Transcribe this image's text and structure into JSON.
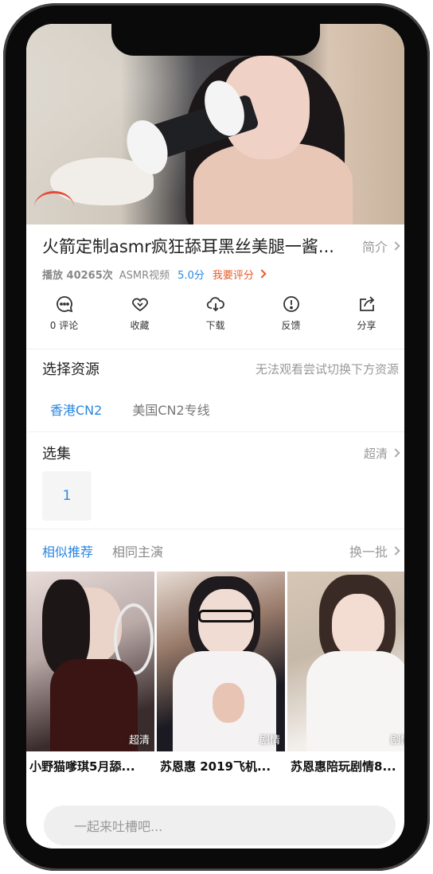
{
  "video": {
    "title": "火箭定制asmr疯狂舔耳黑丝美腿一酱...",
    "intro_label": "简介"
  },
  "meta": {
    "plays": "播放 40265次",
    "category": "ASMR视频",
    "score": "5.0分",
    "rate_label": "我要评分"
  },
  "actions": [
    {
      "label": "0 评论",
      "icon": "comment-icon"
    },
    {
      "label": "收藏",
      "icon": "favorite-icon"
    },
    {
      "label": "下载",
      "icon": "download-icon"
    },
    {
      "label": "反馈",
      "icon": "feedback-icon"
    },
    {
      "label": "分享",
      "icon": "share-icon"
    }
  ],
  "source_section": {
    "title": "选择资源",
    "hint": "无法观看尝试切换下方资源",
    "sources": [
      "香港CN2",
      "美国CN2专线"
    ],
    "active": 0
  },
  "episode_section": {
    "title": "选集",
    "quality": "超清",
    "episodes": [
      "1"
    ]
  },
  "recommend": {
    "tabs": [
      "相似推荐",
      "相同主演"
    ],
    "refresh_label": "换一批",
    "items": [
      {
        "caption": "小野猫嗲琪5月舔...",
        "badge": "超清"
      },
      {
        "caption": "苏恩惠 2019飞机...",
        "badge": "剧情"
      },
      {
        "caption": "苏恩惠陪玩剧情8...",
        "badge": "剧情"
      }
    ]
  },
  "comment": {
    "placeholder": "一起来吐槽吧..."
  },
  "colors": {
    "accent": "#2a86e0",
    "rate": "#e85a2a"
  }
}
